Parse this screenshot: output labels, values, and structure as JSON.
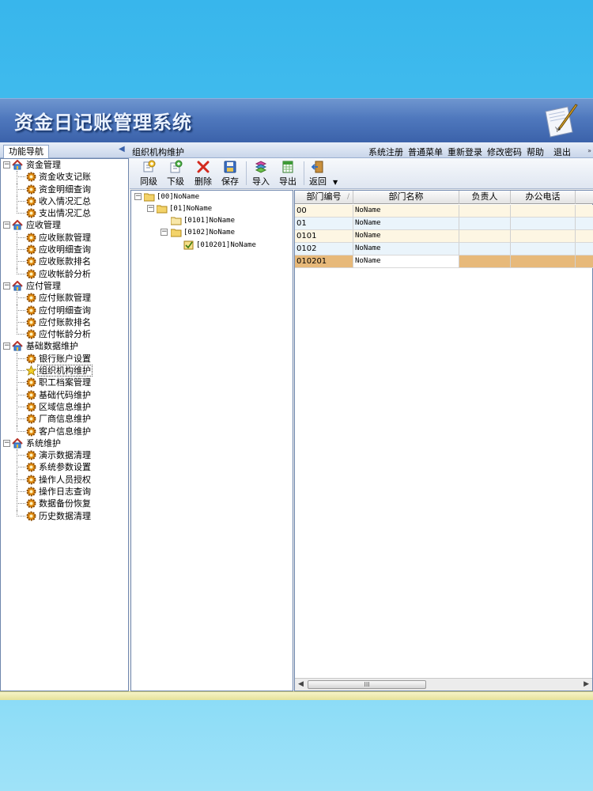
{
  "app": {
    "title": "资金日记账管理系统",
    "nav_tab": "功能导航",
    "page_title": "组织机构维护",
    "top_menu": [
      "系统注册",
      "普通菜单",
      "重新登录",
      "修改密码",
      "帮助",
      "退出"
    ]
  },
  "sidebar": {
    "groups": [
      {
        "label": "资金管理",
        "items": [
          "资金收支记账",
          "资金明细查询",
          "收入情况汇总",
          "支出情况汇总"
        ]
      },
      {
        "label": "应收管理",
        "items": [
          "应收账款管理",
          "应收明细查询",
          "应收账款排名",
          "应收帐龄分析"
        ]
      },
      {
        "label": "应付管理",
        "items": [
          "应付账款管理",
          "应付明细查询",
          "应付账款排名",
          "应付帐龄分析"
        ]
      },
      {
        "label": "基础数据维护",
        "items": [
          "银行账户设置",
          "组织机构维护",
          "职工档案管理",
          "基础代码维护",
          "区域信息维护",
          "厂商信息维护",
          "客户信息维护"
        ]
      },
      {
        "label": "系统维护",
        "items": [
          "演示数据清理",
          "系统参数设置",
          "操作人员授权",
          "操作日志查询",
          "数据备份恢复",
          "历史数据清理"
        ]
      }
    ],
    "selected_item": "组织机构维护"
  },
  "toolbar": {
    "same_level": "同级",
    "sub_level": "下级",
    "delete": "删除",
    "save": "保存",
    "import": "导入",
    "export": "导出",
    "back": "返回"
  },
  "org_tree": {
    "nodes": [
      "[00]NoName",
      "[01]NoName",
      "[0101]NoName",
      "[0102]NoName",
      "[010201]NoName"
    ]
  },
  "grid": {
    "columns": [
      "部门编号",
      "部门名称",
      "负责人",
      "办公电话"
    ],
    "rows": [
      {
        "code": "00",
        "name": "NoName",
        "manager": "",
        "phone": ""
      },
      {
        "code": "01",
        "name": "NoName",
        "manager": "",
        "phone": ""
      },
      {
        "code": "0101",
        "name": "NoName",
        "manager": "",
        "phone": ""
      },
      {
        "code": "0102",
        "name": "NoName",
        "manager": "",
        "phone": ""
      },
      {
        "code": "010201",
        "name": "NoName",
        "manager": "",
        "phone": ""
      }
    ],
    "selected_row": "010201",
    "scroll_thumb_text": "III"
  },
  "colors": {
    "banner": "#3b62aa",
    "selected_row": "#e7b97a",
    "row_alt_a": "#fdf6e3",
    "row_alt_b": "#eaf4fb",
    "gear": "#e08a10"
  },
  "icons": [
    "house-icon",
    "gear-icon",
    "star-icon",
    "folder-icon",
    "checkbox-icon",
    "collapse-arrow-icon"
  ]
}
